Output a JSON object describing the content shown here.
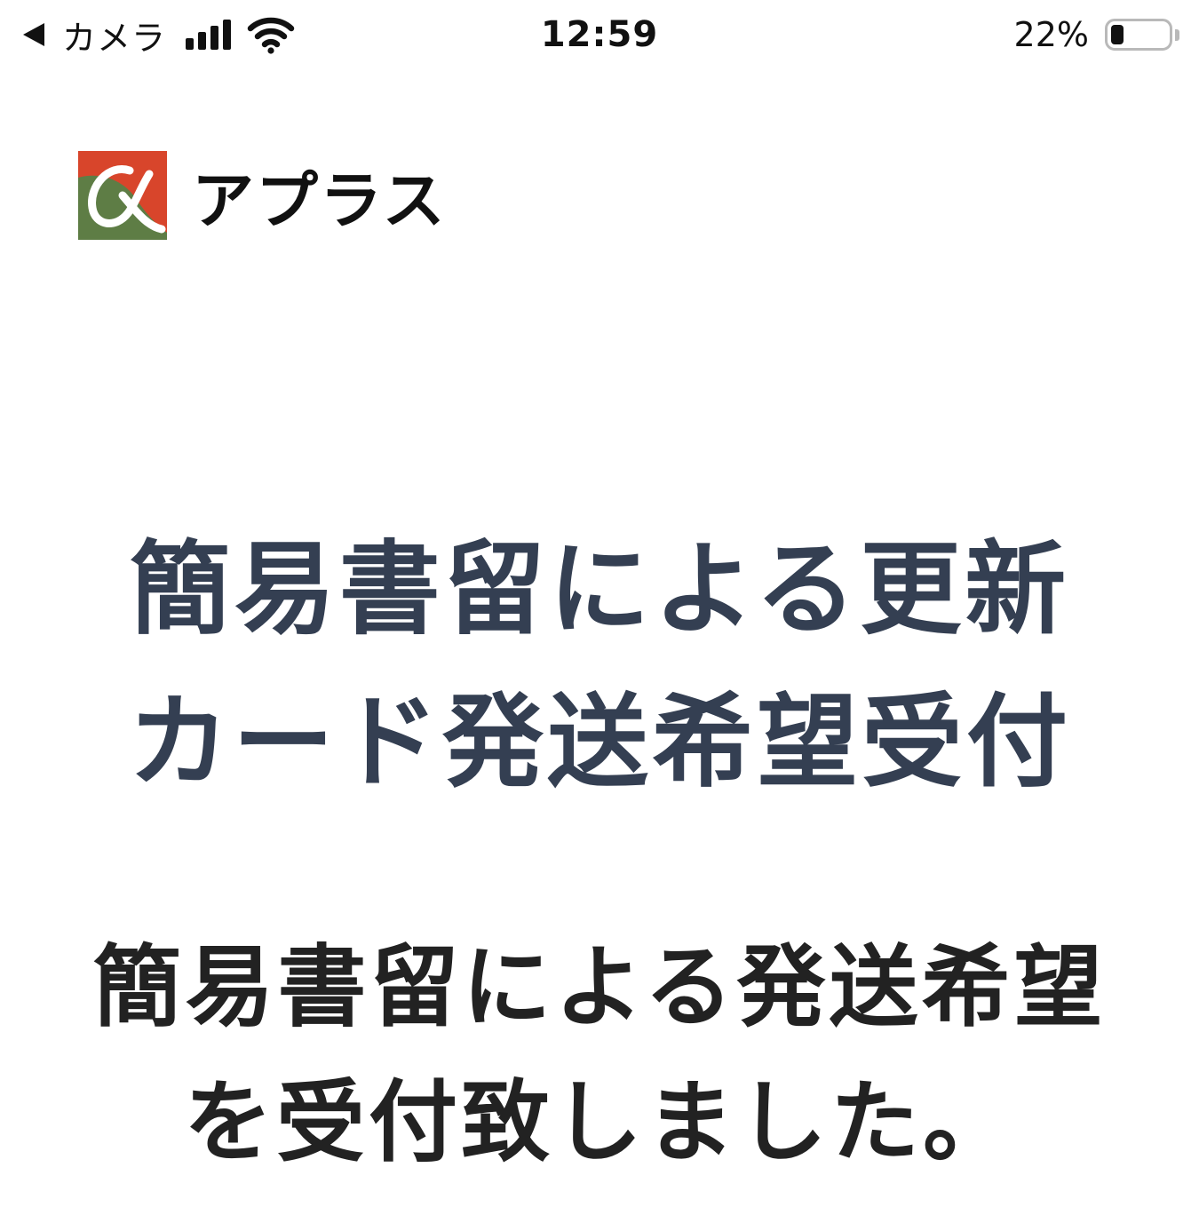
{
  "status_bar": {
    "back_label": "カメラ",
    "time": "12:59",
    "battery_percent": "22%",
    "battery_level": 0.22,
    "signal_bars": 4
  },
  "brand": {
    "name": "アプラス",
    "colors": {
      "red": "#d8452b",
      "green": "#5e7d45"
    }
  },
  "page": {
    "title_line1": "簡易書留による更新",
    "title_line2": "カード発送希望受付",
    "message_line1": "簡易書留による発送希望",
    "message_line2": "を受付致しました。"
  },
  "colors": {
    "title": "#343f52",
    "message": "#222222"
  },
  "icons": {
    "back": "back-arrow-icon",
    "signal": "cellular-signal-icon",
    "wifi": "wifi-icon",
    "battery": "battery-icon"
  }
}
